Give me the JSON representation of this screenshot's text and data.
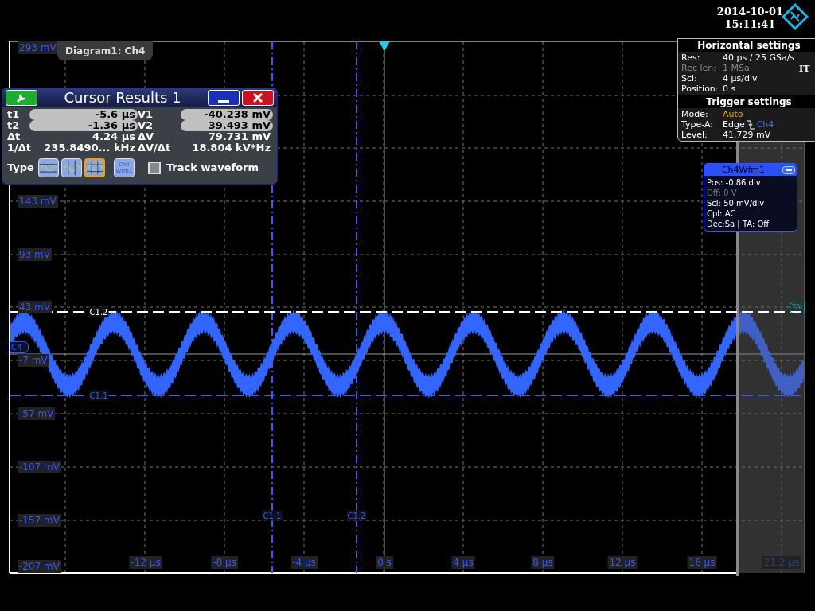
{
  "datetime": {
    "date": "2014-10-01",
    "time": "15:11:41"
  },
  "diagram_tab": "Diagram1: Ch4",
  "cursor_results": {
    "title": "Cursor Results 1",
    "rows": [
      {
        "kind": "field",
        "cells": [
          {
            "label": "t1",
            "value": "-5.6 µs"
          },
          {
            "label": "V1",
            "value": "-40.238 mV"
          }
        ]
      },
      {
        "kind": "field",
        "cells": [
          {
            "label": "t2",
            "value": "-1.36 µs"
          },
          {
            "label": "V2",
            "value": "39.493 mV"
          }
        ]
      },
      {
        "kind": "plain",
        "cells": [
          {
            "label": "Δt",
            "value": "4.24 µs"
          },
          {
            "label": "ΔV",
            "value": "79.731 mV"
          }
        ]
      },
      {
        "kind": "plain",
        "cells": [
          {
            "label": "1/Δt",
            "value": "235.8490... kHz"
          },
          {
            "label": "ΔV/Δt",
            "value": "18.804 kV*Hz"
          }
        ]
      }
    ],
    "type_label": "Type",
    "types": [
      {
        "kind": "horizontal",
        "selected": false
      },
      {
        "kind": "vertical",
        "selected": false
      },
      {
        "kind": "both",
        "selected": true
      },
      {
        "kind": "waveform",
        "label": "Ch4 Wfm1",
        "selected": false
      }
    ],
    "track_waveform": {
      "label": "Track waveform",
      "checked": false
    }
  },
  "horizontal_settings": {
    "title": "Horizontal settings",
    "side_label": "IT",
    "rows": [
      {
        "label": "Res:",
        "value": "40 ps / 25 GSa/s",
        "disabled": false
      },
      {
        "label": "Rec len:",
        "value": "1 MSa",
        "disabled": true
      },
      {
        "label": "Scl:",
        "value": "4 µs/div",
        "disabled": false
      },
      {
        "label": "Position:",
        "value": "0 s",
        "disabled": false
      }
    ]
  },
  "trigger_settings": {
    "title": "Trigger settings",
    "rows": [
      {
        "kind": "highlight",
        "label": "Mode:",
        "value": "Auto"
      },
      {
        "kind": "edge",
        "label": "Type-A:",
        "value": "Edge",
        "source": "Ch4"
      },
      {
        "kind": "plain",
        "label": "Level:",
        "value": "41.729 mV"
      }
    ]
  },
  "waveform_box": {
    "title": "Ch4Wfm1",
    "rows": [
      {
        "text": "Pos: -0.86 div",
        "disabled": false
      },
      {
        "text": "Off: 0 V",
        "disabled": true
      },
      {
        "text": "Scl: 50 mV/div",
        "disabled": false
      },
      {
        "text": "Cpl: AC",
        "disabled": false
      },
      {
        "text": "Dec:Sa | TA: Off",
        "disabled": false
      }
    ]
  },
  "plot": {
    "y_labels": [
      "293 mV",
      "143 mV",
      "93 mV",
      "43 mV",
      "-7 mV",
      "-57 mV",
      "-107 mV",
      "-157 mV",
      "-207 mV"
    ],
    "x_labels": [
      {
        "text": "-12 µs",
        "disabled": false
      },
      {
        "text": "-8 µs",
        "disabled": false
      },
      {
        "text": "-4 µs",
        "disabled": false
      },
      {
        "text": "0 s",
        "disabled": false
      },
      {
        "text": "4 µs",
        "disabled": false
      },
      {
        "text": "8 µs",
        "disabled": false
      },
      {
        "text": "12 µs",
        "disabled": false
      },
      {
        "text": "16 µs",
        "disabled": false
      },
      {
        "text": "21.2 µs",
        "disabled": true
      }
    ],
    "cursors": [
      {
        "kind": "vertical",
        "label": "C1.1"
      },
      {
        "kind": "vertical",
        "label": "C1.2"
      },
      {
        "kind": "horizontal",
        "label": "C1.2"
      },
      {
        "kind": "horizontal",
        "label": "C1.1"
      }
    ],
    "channel_marker": "C4",
    "trigger_marker": "TA"
  }
}
